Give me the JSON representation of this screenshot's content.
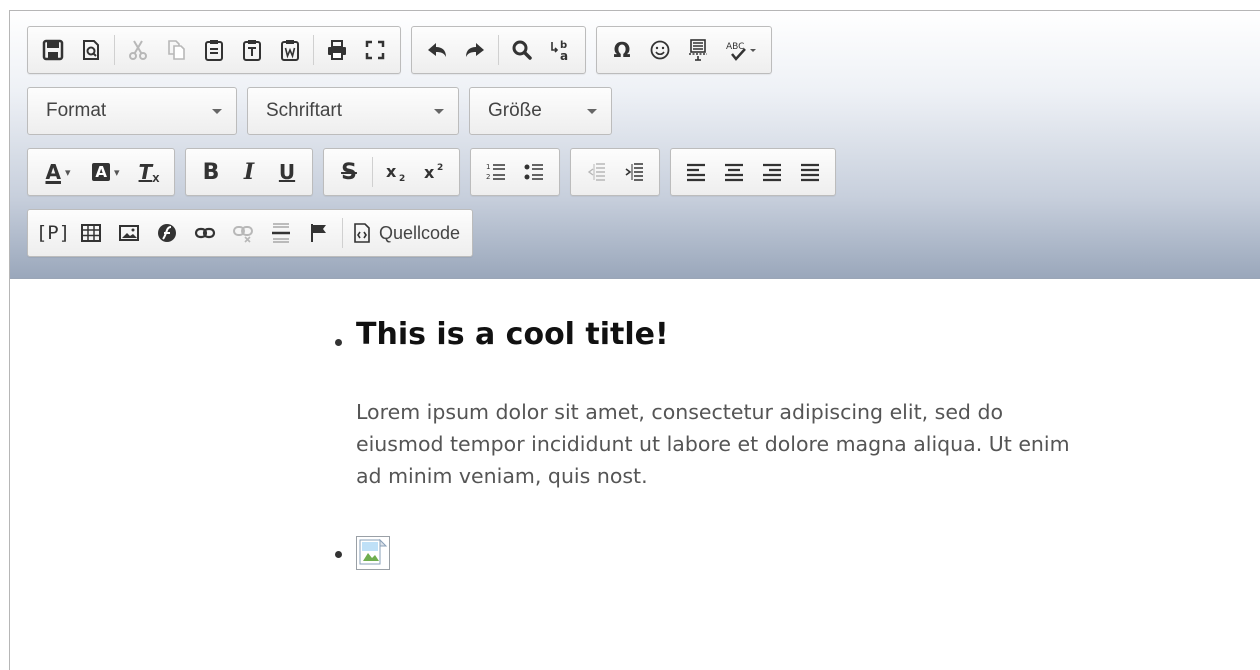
{
  "toolbar": {
    "format_label": "Format",
    "font_label": "Schriftart",
    "size_label": "Größe",
    "source_label": "Quellcode",
    "paragraph_label": "[P]",
    "bold_label": "B",
    "italic_label": "I",
    "underline_label": "U",
    "strike_label": "S",
    "clear_format_label": "T",
    "text_color_label": "A",
    "bg_color_label": "A"
  },
  "content": {
    "title": "This is a cool title!",
    "paragraph": "Lorem ipsum dolor sit amet, consectetur adipiscing elit, sed do eiusmod tempor incididunt ut labore et dolore magna aliqua. Ut enim ad minim veniam, quis nost."
  }
}
